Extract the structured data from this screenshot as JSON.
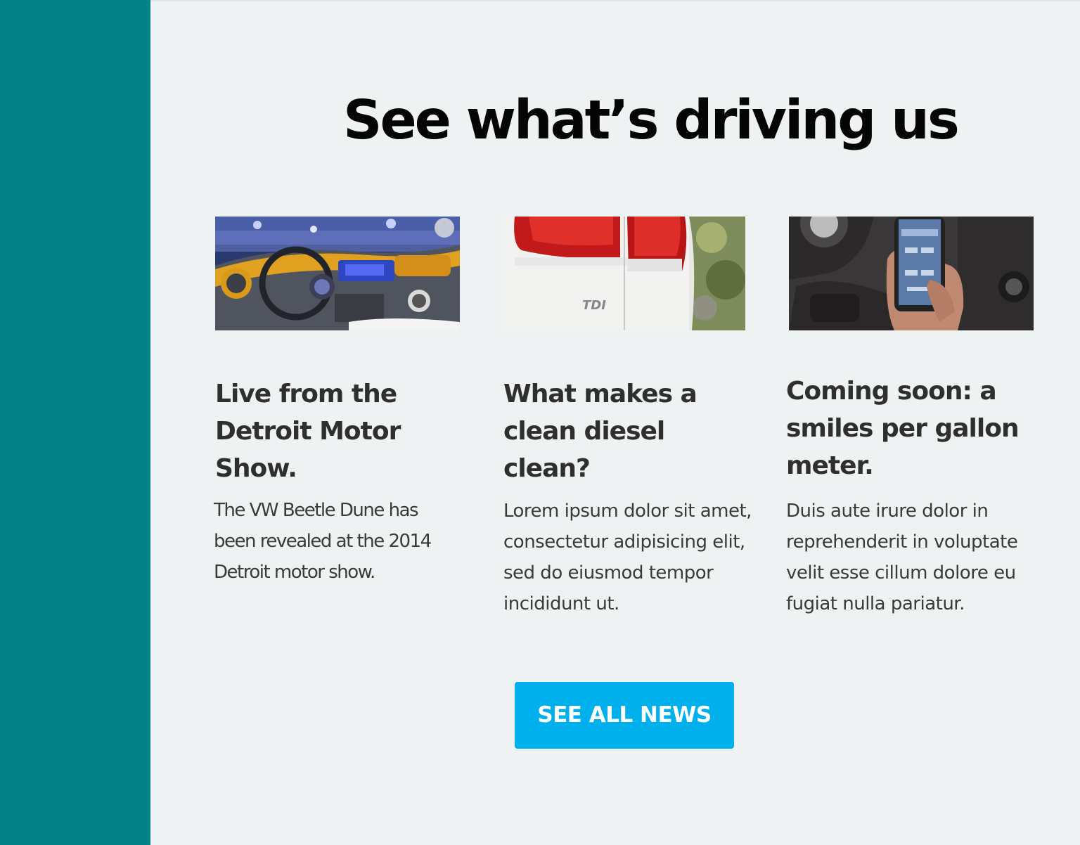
{
  "sidebar": {
    "color": "#038386"
  },
  "section": {
    "headline": "See what’s driving us",
    "background": "#eff2f3"
  },
  "cards": [
    {
      "image_icon": "car-dashboard-photo",
      "title_lines": [
        "Live from the",
        "Detroit Motor",
        "Show."
      ],
      "body_lines": [
        "The VW Beetle Dune has",
        "been revealed at the 2014",
        "Detroit motor show."
      ]
    },
    {
      "image_icon": "tail-light-tdi-photo",
      "title_lines": [
        "What makes a",
        "clean diesel",
        "clean?"
      ],
      "body_lines": [
        "Lorem ipsum dolor sit amet,",
        "consectetur adipisicing elit,",
        "sed do eiusmod tempor",
        "incididunt ut."
      ]
    },
    {
      "image_icon": "phone-in-car-photo",
      "title_lines": [
        "Coming soon: a",
        "smiles per gallon",
        "meter."
      ],
      "body_lines": [
        "Duis aute irure dolor in",
        "reprehenderit in voluptate",
        "velit esse cillum dolore eu",
        "fugiat nulla pariatur."
      ]
    }
  ],
  "cta": {
    "label": "SEE ALL NEWS",
    "color": "#00b0ec"
  }
}
